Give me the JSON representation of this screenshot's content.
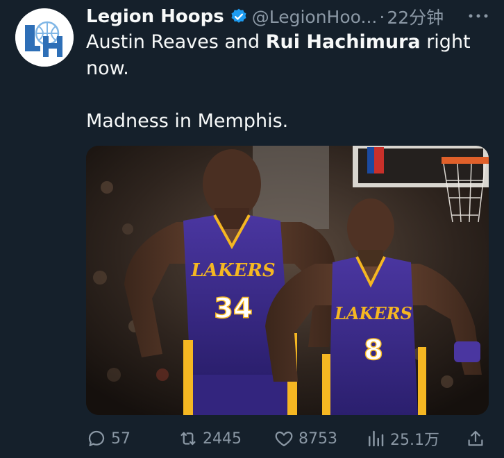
{
  "tweet": {
    "display_name": "Legion Hoops",
    "handle": "@LegionHoo...",
    "separator": "·",
    "time": "22分钟",
    "more_icon": "more-dots-icon",
    "avatar_text": "LH",
    "text_line1_plain": "Austin Reaves and ",
    "text_line1_bold": "Rui Hachimura",
    "text_line1_end": " right",
    "text_line2": "now.",
    "text_line3": "Madness in Memphis.",
    "image": {
      "player1_number": "34",
      "player2_number": "8",
      "jersey_text": "LAKERS",
      "jersey_color": "#3d2b8a",
      "jersey_trim": "#f5b722"
    },
    "actions": {
      "replies": "57",
      "retweets": "2445",
      "likes": "8753",
      "views": "25.1万"
    },
    "colors": {
      "background": "#15202b",
      "muted": "#8b98a5",
      "verified_blue": "#1d9bf0"
    }
  }
}
